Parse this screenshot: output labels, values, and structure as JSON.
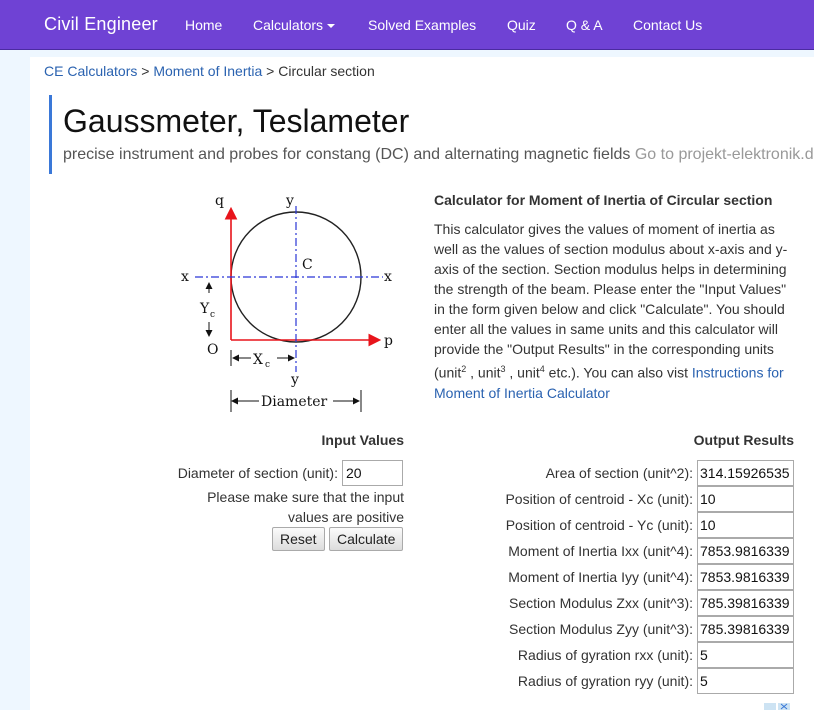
{
  "navbar": {
    "brand": "Civil Engineer",
    "items": [
      {
        "label": "Home"
      },
      {
        "label": "Calculators"
      },
      {
        "label": "Solved Examples"
      },
      {
        "label": "Quiz"
      },
      {
        "label": "Q & A"
      },
      {
        "label": "Contact Us"
      }
    ]
  },
  "breadcrumb": {
    "items": [
      {
        "label": "CE Calculators"
      },
      {
        "label": "Moment of Inertia"
      },
      {
        "label": "Circular section"
      }
    ],
    "separator": ">"
  },
  "ad": {
    "title": "Gaussmeter, Teslameter",
    "text": "precise instrument and probes for constang (DC) and alternating magnetic fields",
    "link": "Go to projekt-elektronik.de"
  },
  "diagram": {
    "labels": {
      "q": "q",
      "y_top": "y",
      "y_bottom": "y",
      "c": "C",
      "x_left": "x",
      "x_right": "x",
      "yc": "Y",
      "yc_sub": "c",
      "o": "O",
      "p": "p",
      "xc": "X",
      "xc_sub": "c",
      "diameter": "Diameter"
    }
  },
  "calculator": {
    "title": "Calculator for Moment of Inertia of Circular section",
    "description": "This calculator gives the values of moment of inertia as well as the values of section modulus about x-axis and y-axis of the section. Section modulus helps in determining the strength of the beam. Please enter the \"Input Values\" in the form given below and click \"Calculate\". You should enter all the values in same units and this calculator will provide the \"Output Results\" in the corresponding units (unit",
    "unit_sup_2": "2",
    "unit_sep_1": " , unit",
    "unit_sup_3": "3",
    "unit_sep_2": " , unit",
    "unit_sup_4": "4",
    "description_tail": " etc.). You can also vist ",
    "instructions_link": "Instructions for Moment of Inertia Calculator"
  },
  "input": {
    "heading": "Input Values",
    "diameter_label": "Diameter of section (unit):",
    "diameter_value": "20",
    "note": "Please make sure that the input values are positive",
    "reset_label": "Reset",
    "calculate_label": "Calculate"
  },
  "output": {
    "heading": "Output Results",
    "rows": [
      {
        "label": "Area of section (unit^2):",
        "value": "314.15926535"
      },
      {
        "label": "Position of centroid - Xc (unit):",
        "value": "10"
      },
      {
        "label": "Position of centroid - Yc (unit):",
        "value": "10"
      },
      {
        "label": "Moment of Inertia Ixx (unit^4):",
        "value": "7853.9816339"
      },
      {
        "label": "Moment of Inertia Iyy (unit^4):",
        "value": "7853.9816339"
      },
      {
        "label": "Section Modulus Zxx (unit^3):",
        "value": "785.39816339"
      },
      {
        "label": "Section Modulus Zyy (unit^3):",
        "value": "785.39816339"
      },
      {
        "label": "Radius of gyration rxx (unit):",
        "value": "5"
      },
      {
        "label": "Radius of gyration ryy (unit):",
        "value": "5"
      }
    ]
  },
  "colors": {
    "navbar": "#6f42d4",
    "link": "#2a62b0",
    "ad_border": "#3a78d8",
    "axis_red": "#e8141b",
    "axis_blue": "#2a36d6"
  }
}
